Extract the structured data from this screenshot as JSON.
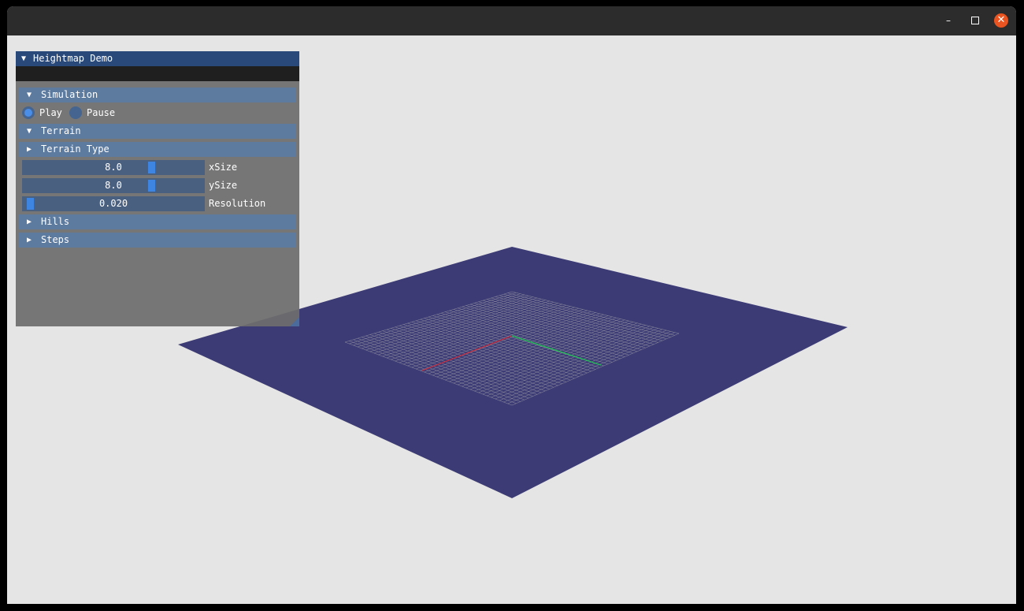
{
  "window": {
    "controls": {
      "minimize": "–",
      "close": "✕"
    }
  },
  "panel": {
    "title": "Heightmap Demo",
    "simulation": {
      "header": "Simulation",
      "options": [
        "Play",
        "Pause"
      ],
      "selected": "Play"
    },
    "terrain": {
      "header": "Terrain",
      "terrain_type_header": "Terrain Type",
      "sliders": [
        {
          "label": "xSize",
          "value": "8.0",
          "fraction": 0.72
        },
        {
          "label": "ySize",
          "value": "8.0",
          "fraction": 0.72
        },
        {
          "label": "Resolution",
          "value": "0.020",
          "fraction": 0.02
        }
      ]
    },
    "hills_header": "Hills",
    "steps_header": "Steps",
    "expanded_arrow": "▼",
    "collapsed_arrow": "▶"
  },
  "scene": {
    "plane_color": "#3c3b75",
    "grid_color": "#8d8c9e",
    "x_axis_color": "#cc2a3a",
    "y_axis_color": "#22c255"
  }
}
